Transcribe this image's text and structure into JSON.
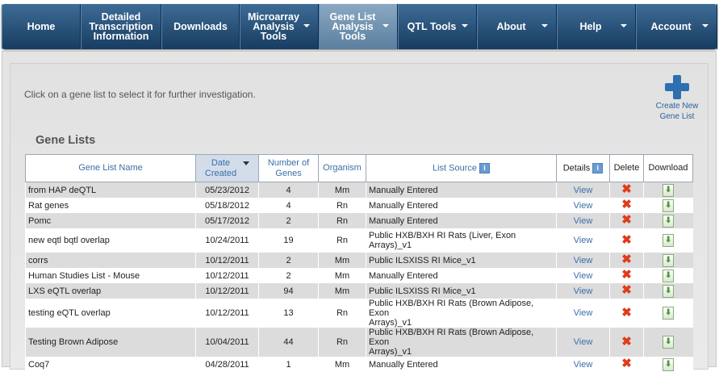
{
  "nav": {
    "home": "Home",
    "detailed_line1": "Detailed",
    "detailed_line2": "Transcription",
    "detailed_line3": "Information",
    "downloads": "Downloads",
    "micro_line1": "Microarray",
    "micro_line2": "Analysis",
    "micro_line3": "Tools",
    "genelist_line1": "Gene List",
    "genelist_line2": "Analysis",
    "genelist_line3": "Tools",
    "qtl": "QTL Tools",
    "about": "About",
    "help": "Help",
    "account": "Account"
  },
  "instructions": "Click on a gene list to select it for further investigation.",
  "create": {
    "line1": "Create New",
    "line2": "Gene List",
    "icon": "plus-icon"
  },
  "section_title": "Gene Lists",
  "table": {
    "headers": {
      "name": "Gene List Name",
      "date_line1": "Date",
      "date_line2": "Created",
      "genes_line1": "Number of",
      "genes_line2": "Genes",
      "organism": "Organism",
      "source": "List Source",
      "details": "Details",
      "delete": "Delete",
      "download": "Download"
    },
    "view_label": "View",
    "rows": [
      {
        "name": "from HAP deQTL",
        "date": "05/23/2012",
        "genes": "4",
        "organism": "Mm",
        "source1": "Manually Entered",
        "source2": ""
      },
      {
        "name": "Rat genes",
        "date": "05/18/2012",
        "genes": "4",
        "organism": "Rn",
        "source1": "Manually Entered",
        "source2": ""
      },
      {
        "name": "Pomc",
        "date": "05/17/2012",
        "genes": "2",
        "organism": "Rn",
        "source1": "Manually Entered",
        "source2": ""
      },
      {
        "name": "new eqtl bqtl overlap",
        "date": "10/24/2011",
        "genes": "19",
        "organism": "Rn",
        "source1": "Public HXB/BXH RI Rats (Liver, Exon",
        "source2": "Arrays)_v1"
      },
      {
        "name": "corrs",
        "date": "10/12/2011",
        "genes": "2",
        "organism": "Mm",
        "source1": "Public ILSXISS RI Mice_v1",
        "source2": ""
      },
      {
        "name": "Human Studies List - Mouse",
        "date": "10/12/2011",
        "genes": "2",
        "organism": "Mm",
        "source1": "Manually Entered",
        "source2": ""
      },
      {
        "name": "LXS eQTL overlap",
        "date": "10/12/2011",
        "genes": "94",
        "organism": "Mm",
        "source1": "Public ILSXISS RI Mice_v1",
        "source2": ""
      },
      {
        "name": "testing eQTL overlap",
        "date": "10/12/2011",
        "genes": "13",
        "organism": "Rn",
        "source1": "Public HXB/BXH RI Rats (Brown Adipose, Exon",
        "source2": "Arrays)_v1"
      },
      {
        "name": "Testing Brown Adipose",
        "date": "10/04/2011",
        "genes": "44",
        "organism": "Rn",
        "source1": "Public HXB/BXH RI Rats (Brown Adipose, Exon",
        "source2": "Arrays)_v1"
      },
      {
        "name": "Coq7",
        "date": "04/28/2011",
        "genes": "1",
        "organism": "Mm",
        "source1": "Manually Entered",
        "source2": ""
      }
    ]
  },
  "icons": {
    "info": "info-icon",
    "delete": "delete-x-icon",
    "download": "download-arrow-icon",
    "sort": "sort-down-icon"
  },
  "colors": {
    "nav_top": "#3e6c96",
    "nav_bottom": "#173c61",
    "active_tab": "#8aa8c3",
    "link": "#3a6fa8",
    "delete_red": "#e03a1a",
    "download_green": "#4f9a3b"
  }
}
